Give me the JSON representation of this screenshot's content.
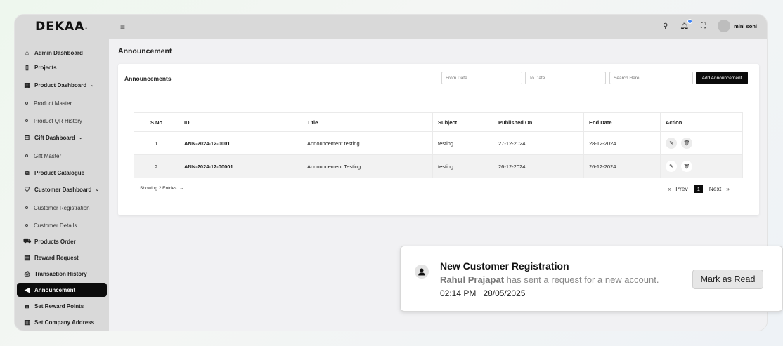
{
  "brand": {
    "name": "DEKAA",
    "dot": "."
  },
  "sidebar": {
    "items": [
      {
        "label": "Admin Dashboard",
        "icon": "home-icon",
        "glyph": "⌂",
        "type": "main"
      },
      {
        "label": "Projects",
        "icon": "projects-icon",
        "glyph": "▯",
        "type": "main"
      },
      {
        "label": "Product Dashboard",
        "icon": "grid-icon",
        "glyph": "▦",
        "type": "main",
        "chevron": "⌄"
      },
      {
        "label": "Product Master",
        "type": "sub"
      },
      {
        "label": "Product QR History",
        "type": "sub"
      },
      {
        "label": "Gift Dashboard",
        "icon": "gift-icon",
        "glyph": "⊞",
        "type": "main",
        "chevron": "⌄"
      },
      {
        "label": "Gift Master",
        "type": "sub"
      },
      {
        "label": "Product Catalogue",
        "icon": "catalogue-icon",
        "glyph": "⧉",
        "type": "main"
      },
      {
        "label": "Customer Dashboard",
        "icon": "customer-icon",
        "glyph": "⛉",
        "type": "main",
        "chevron": "⌄"
      },
      {
        "label": "Customer Registration",
        "type": "sub"
      },
      {
        "label": "Customer Details",
        "type": "sub"
      },
      {
        "label": "Products Order",
        "icon": "cart-icon",
        "glyph": "⛟",
        "type": "main"
      },
      {
        "label": "Reward Request",
        "icon": "reward-icon",
        "glyph": "▤",
        "type": "main"
      },
      {
        "label": "Transaction History",
        "icon": "transaction-icon",
        "glyph": "⎙",
        "type": "main"
      },
      {
        "label": "Announcement",
        "icon": "megaphone-icon",
        "glyph": "◀",
        "type": "main",
        "active": true
      },
      {
        "label": "Set Reward Points",
        "icon": "points-icon",
        "glyph": "⧇",
        "type": "main"
      },
      {
        "label": "Set Company Address",
        "icon": "building-icon",
        "glyph": "▥",
        "type": "main"
      }
    ]
  },
  "header": {
    "menu_glyph": "≡",
    "search_glyph": "⚲",
    "bell_glyph": "🔔︎",
    "fullscreen_glyph": "⛶",
    "user_name": "mini soni"
  },
  "page": {
    "title": "Announcement"
  },
  "card": {
    "title": "Announcements",
    "from_date_placeholder": "From Date",
    "to_date_placeholder": "To Date",
    "search_placeholder": "Search Here",
    "add_button": "Add Announcement"
  },
  "table": {
    "headers": [
      "S.No",
      "ID",
      "Title",
      "Subject",
      "Published On",
      "End Date",
      "Action"
    ],
    "rows": [
      {
        "sno": "1",
        "id": "ANN-2024-12-0001",
        "title": "Announcement testing",
        "subject": "testing",
        "published": "27-12-2024",
        "end": "28-12-2024"
      },
      {
        "sno": "2",
        "id": "ANN-2024-12-00001",
        "title": "Announcement Testing",
        "subject": "testing",
        "published": "26-12-2024",
        "end": "26-12-2024"
      }
    ],
    "edit_glyph": "✎",
    "delete_glyph": "🗑︎"
  },
  "footer": {
    "showing": "Showing 2 Entries",
    "showing_arrow": "→",
    "first": "«",
    "prev": "Prev",
    "page": "1",
    "next": "Next",
    "last": "»"
  },
  "toast": {
    "title": "New Customer Registration",
    "sender": "Rahul Prajapat",
    "message": " has sent a request for a new account.",
    "time": "02:14 PM",
    "date": "28/05/2025",
    "button": "Mark as Read"
  }
}
